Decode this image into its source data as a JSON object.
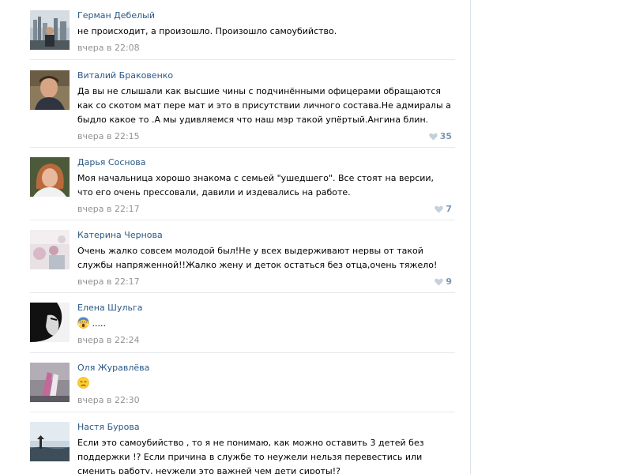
{
  "comments": [
    {
      "author": "Герман Дебелый",
      "text": "не происходит, а произошло. Произошло самоубийство.",
      "date": "вчера в 22:08",
      "likes": ""
    },
    {
      "author": "Виталий Браковенко",
      "text": "Да вы не слышали как высшие чины с подчинёнными офицерами обращаются как со скотом мат пере мат и это в присутствии личного состава.Не адмиралы а быдло какое то .А мы удивляемся что наш мэр такой упёртый.Ангина блин.",
      "date": "вчера в 22:15",
      "likes": "35"
    },
    {
      "author": "Дарья Соснова",
      "text": "Моя начальница хорошо знакома с семьей \"ушедшего\". Все стоят на версии, что его очень прессовали, давили и издевались на работе.",
      "date": "вчера в 22:17",
      "likes": "7"
    },
    {
      "author": "Катерина Чернова",
      "text": "Очень жалко совсем молодой был!Не у всех выдерживают нервы от такой службы напряженной!!Жалко жену и деток остаться без отца,очень тяжело!",
      "date": "вчера в 22:17",
      "likes": "9"
    },
    {
      "author": "Елена Шульга",
      "text": ".....",
      "emoji": "scream-emoji",
      "date": "вчера в 22:24",
      "likes": ""
    },
    {
      "author": "Оля Журавлёва",
      "text": "",
      "emoji": "sad-emoji",
      "date": "вчера в 22:30",
      "likes": ""
    },
    {
      "author": "Настя Бурова",
      "text": "Если это самоубийство , то я не понимаю, как можно оставить 3 детей без поддержки !? Если причина в службе то неужели нельзя перевестись или сменить работу, неужели это важней чем дети сироты!?",
      "date": "",
      "likes": ""
    }
  ],
  "colors": {
    "link": "#2a5885",
    "date": "#939393",
    "like": "#7c96b2",
    "separator": "#e7e8ec"
  },
  "icons": {
    "like": "heart-icon"
  }
}
